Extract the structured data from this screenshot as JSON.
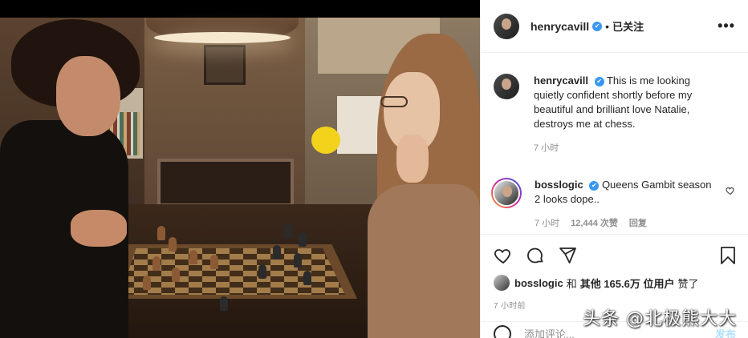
{
  "header": {
    "username": "henrycavill",
    "verified_mark": "✔",
    "separator": "•",
    "follow_status": "已关注",
    "more_label": "•••"
  },
  "caption": {
    "username": "henrycavill",
    "verified_mark": "✔",
    "text": "This is me looking quietly confident shortly before my beautiful and brilliant love Natalie, destroys me at chess.",
    "time": "7 小时"
  },
  "comment": {
    "username": "bosslogic",
    "verified_mark": "✔",
    "text": "Queens Gambit season 2 looks dope..",
    "time": "7 小时",
    "likes": "12,444 次赞",
    "reply": "回复"
  },
  "actions": {
    "icons": [
      "heart-icon",
      "comment-icon",
      "share-icon",
      "bookmark-icon"
    ]
  },
  "likes": {
    "liker": "bosslogic",
    "and": "和",
    "others": "其他 165.6万 位用户",
    "liked": "赞了"
  },
  "post_time": "7 小时前",
  "add_comment": {
    "placeholder": "添加评论...",
    "post_label": "发布"
  },
  "watermark": "头条 @北极熊大大",
  "colors": {
    "verified": "#3897f0",
    "text": "#262626",
    "muted": "#8e8e8e",
    "post_disabled": "#b2dffc"
  }
}
